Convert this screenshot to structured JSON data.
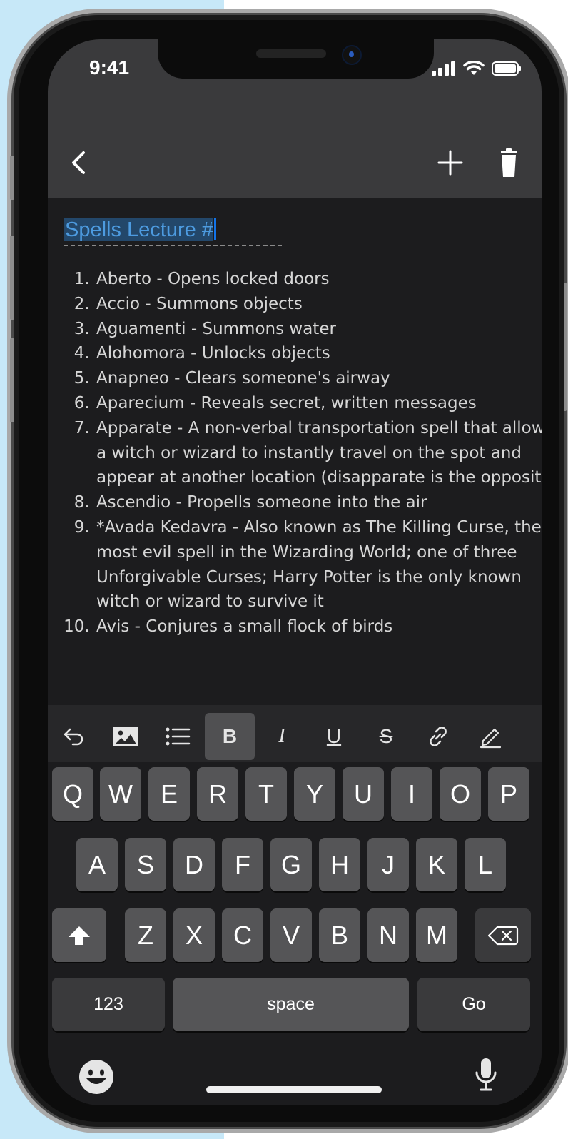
{
  "status_bar": {
    "time": "9:41"
  },
  "nav": {
    "back_icon": "chevron-left-icon",
    "add_icon": "plus-icon",
    "delete_icon": "trash-icon"
  },
  "note": {
    "title": "Spells Lecture #",
    "items": [
      "Aberto - Opens locked doors",
      "Accio - Summons objects",
      "Aguamenti - Summons water",
      "Alohomora - Unlocks objects",
      "Anapneo - Clears someone's airway",
      "Aparecium - Reveals secret, written messages",
      "Apparate - A non-verbal transportation spell that allows a witch or wizard to instantly travel on the spot and appear at another location (disapparate is the opposite)",
      "Ascendio - Propells someone into the air",
      "*Avada Kedavra - Also known as The Killing Curse, the most evil spell in the Wizarding World; one of three Unforgivable Curses; Harry Potter is the only known witch or wizard to survive it",
      "Avis - Conjures a small flock of birds"
    ]
  },
  "toolbar": {
    "bold": "B",
    "italic": "I",
    "underline": "U",
    "strike": "S",
    "active_tool": "bold"
  },
  "keyboard": {
    "row1": [
      "Q",
      "W",
      "E",
      "R",
      "T",
      "Y",
      "U",
      "I",
      "O",
      "P"
    ],
    "row2": [
      "A",
      "S",
      "D",
      "F",
      "G",
      "H",
      "J",
      "K",
      "L"
    ],
    "row3": [
      "Z",
      "X",
      "C",
      "V",
      "B",
      "N",
      "M"
    ],
    "numbers": "123",
    "space": "space",
    "go": "Go"
  },
  "colors": {
    "accent": "#4d9be0",
    "selection": "#23476a",
    "cursor": "#1273e8",
    "key": "#555557",
    "toolbar": "#272729"
  }
}
